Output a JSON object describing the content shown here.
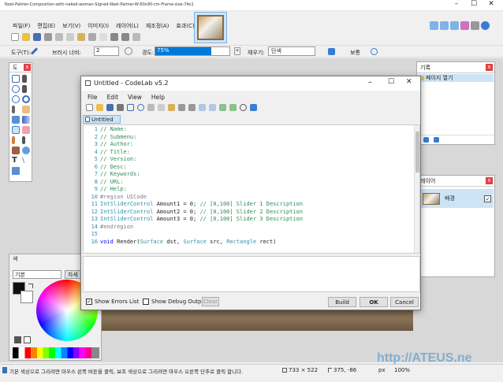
{
  "app": {
    "title": "Noel-Palmer-Composition-with-naked-woman-Signed-Noel-Palmer-W-60x90-cm-Frame-size-74x102-cm_1570546..."
  },
  "menu": [
    "파일(F)",
    "편집(E)",
    "보기(V)",
    "이미지(I)",
    "레이어(L)",
    "재조정(A)",
    "효과(C)"
  ],
  "toolbar2": {
    "tool_label": "도구(T):",
    "brush_label": "브러시 너비:",
    "brush_value": "2",
    "hardness_label": "경도:",
    "hardness_value": "75%",
    "fill_label": "채우기:",
    "fill_value": "단색",
    "blend_label": "보통"
  },
  "tools_panel": {
    "title": "도"
  },
  "history_panel": {
    "title": "기록",
    "item": "페이지 열기"
  },
  "layers_panel": {
    "title": "레이어",
    "layer_name": "배경"
  },
  "colors_panel": {
    "title": "색",
    "mode": "기본",
    "more": "자세"
  },
  "status": {
    "text": "기본 색상으로 그리려면 마우스 왼쪽 버튼을 클릭, 보조 색상으로 그리려면 마우스 오른쪽 단추로 클릭 합니다.",
    "size": "733 × 522",
    "coords": "375, -86",
    "unit": "px",
    "zoom": "100%"
  },
  "watermark": "http://ATEUS.ne",
  "codelab": {
    "title": "Untitled - CodeLab v5.2",
    "menu": [
      "File",
      "Edit",
      "View",
      "Help"
    ],
    "tab": "Untitled",
    "lines": [
      {
        "n": "1",
        "t": "// Name:"
      },
      {
        "n": "2",
        "t": "// Submenu:"
      },
      {
        "n": "3",
        "t": "// Author:"
      },
      {
        "n": "4",
        "t": "// Title:"
      },
      {
        "n": "5",
        "t": "// Version:"
      },
      {
        "n": "6",
        "t": "// Desc:"
      },
      {
        "n": "7",
        "t": "// Keywords:"
      },
      {
        "n": "8",
        "t": "// URL:"
      },
      {
        "n": "9",
        "t": "// Help:"
      },
      {
        "n": "10",
        "t": "#region UICode"
      },
      {
        "n": "11",
        "t": "IntSliderControl Amount1 = 0; // [0,100] Slider 1 Description"
      },
      {
        "n": "12",
        "t": "IntSliderControl Amount2 = 0; // [0,100] Slider 2 Description"
      },
      {
        "n": "13",
        "t": "IntSliderControl Amount3 = 0; // [0,100] Slider 3 Description"
      },
      {
        "n": "14",
        "t": "#endregion"
      },
      {
        "n": "15",
        "t": ""
      },
      {
        "n": "16",
        "t": "void Render(Surface dst, Surface src, Rectangle rect)"
      }
    ],
    "show_errors": "Show Errors List",
    "show_debug": "Show Debug Output",
    "clear": "Clear",
    "build": "Build",
    "ok": "OK",
    "cancel": "Cancel"
  },
  "colors": {
    "accent": "#0078d7",
    "comment": "#2e8b57",
    "keyword": "#2b91af",
    "grey": "#808080"
  }
}
